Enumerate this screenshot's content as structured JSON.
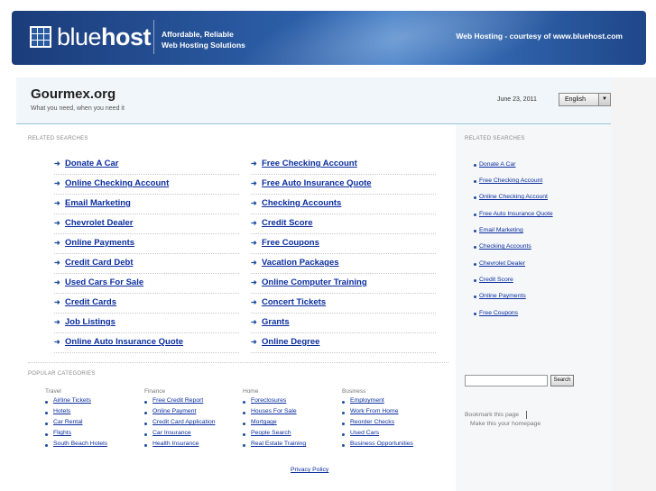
{
  "banner": {
    "logo_light": "blue",
    "logo_bold": "host",
    "tagline_line1": "Affordable, Reliable",
    "tagline_line2": "Web Hosting Solutions",
    "courtesy": "Web Hosting - courtesy of www.bluehost.com"
  },
  "site": {
    "title": "Gourmex.org",
    "subtitle": "What you need, when you need it",
    "date": "June 23, 2011",
    "language": "English"
  },
  "related_label": "RELATED SEARCHES",
  "main_links_left": [
    "Donate A Car",
    "Online Checking Account",
    "Email Marketing",
    "Chevrolet Dealer",
    "Online Payments",
    "Credit Card Debt",
    "Used Cars For Sale",
    "Credit Cards",
    "Job Listings",
    "Online Auto Insurance Quote"
  ],
  "main_links_right": [
    "Free Checking Account",
    "Free Auto Insurance Quote",
    "Checking Accounts",
    "Credit Score",
    "Free Coupons",
    "Vacation Packages",
    "Online Computer Training",
    "Concert Tickets",
    "Grants",
    "Online Degree"
  ],
  "popular_label": "POPULAR CATEGORIES",
  "categories": [
    {
      "head": "Travel",
      "items": [
        "Airline Tickets",
        "Hotels",
        "Car Rental",
        "Flights",
        "South Beach Hotels"
      ]
    },
    {
      "head": "Finance",
      "items": [
        "Free Credit Report",
        "Online Payment",
        "Credit Card Application",
        "Car Insurance",
        "Health Insurance"
      ]
    },
    {
      "head": "Home",
      "items": [
        "Foreclosures",
        "Houses For Sale",
        "Mortgage",
        "People Search",
        "Real Estate Training"
      ]
    },
    {
      "head": "Business",
      "items": [
        "Employment",
        "Work From Home",
        "Reorder Checks",
        "Used Cars",
        "Business Opportunities"
      ]
    }
  ],
  "side_links": [
    "Donate A Car",
    "Free Checking Account",
    "Online Checking Account",
    "Free Auto Insurance Quote",
    "Email Marketing",
    "Checking Accounts",
    "Chevrolet Dealer",
    "Credit Score",
    "Online Payments",
    "Free Coupons"
  ],
  "search": {
    "value": "",
    "button": "Search"
  },
  "bookmark": "Bookmark this page",
  "homepage": "Make this your homepage",
  "privacy": "Privacy Policy",
  "icons": {
    "bullet": "arrow-right-icon",
    "dropdown": "chevron-down-icon",
    "logo": "grid-logo-icon"
  }
}
